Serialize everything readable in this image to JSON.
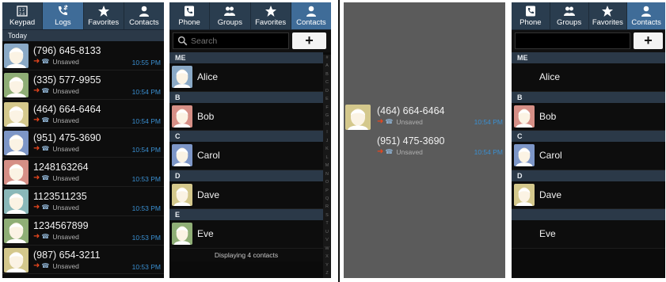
{
  "colors": {
    "tab_bar": "#2a3d4f",
    "tab_active": "#3f6c98",
    "section_header": "#2b3948",
    "time_blue": "#3a8fd1",
    "missed_arrow": "#e8461e"
  },
  "logs_screen": {
    "tabs": [
      {
        "label": "Keypad",
        "icon": "keypad-icon",
        "active": false
      },
      {
        "label": "Logs",
        "icon": "call-log-icon",
        "active": true
      },
      {
        "label": "Favorites",
        "icon": "star-icon",
        "active": false
      },
      {
        "label": "Contacts",
        "icon": "person-icon",
        "active": false
      }
    ],
    "date_header": "Today",
    "entries": [
      {
        "number": "(796) 645-8133",
        "status": "Unsaved",
        "time": "10:55 PM",
        "avatar_color": "#8aa9c6"
      },
      {
        "number": "(335) 577-9955",
        "status": "Unsaved",
        "time": "10:54 PM",
        "avatar_color": "#8fae76"
      },
      {
        "number": "(464) 664-6464",
        "status": "Unsaved",
        "time": "10:54 PM",
        "avatar_color": "#d4c88c"
      },
      {
        "number": "(951) 475-3690",
        "status": "Unsaved",
        "time": "10:54 PM",
        "avatar_color": "#7d96c7"
      },
      {
        "number": "1248163264",
        "status": "Unsaved",
        "time": "10:53 PM",
        "avatar_color": "#d68f86"
      },
      {
        "number": "1123511235",
        "status": "Unsaved",
        "time": "10:53 PM",
        "avatar_color": "#8ab8b9"
      },
      {
        "number": "1234567899",
        "status": "Unsaved",
        "time": "10:53 PM",
        "avatar_color": "#8fae76"
      },
      {
        "number": "(987) 654-3211",
        "status": "Unsaved",
        "time": "10:53 PM",
        "avatar_color": "#d4c88c"
      }
    ]
  },
  "contacts_screen": {
    "tabs": [
      {
        "label": "Phone",
        "icon": "phone-icon",
        "active": false
      },
      {
        "label": "Groups",
        "icon": "groups-icon",
        "active": false
      },
      {
        "label": "Favorites",
        "icon": "star-icon",
        "active": false
      },
      {
        "label": "Contacts",
        "icon": "person-icon",
        "active": true
      }
    ],
    "search_placeholder": "Search",
    "add_label": "+",
    "sections": [
      {
        "header": "ME",
        "name": "Alice",
        "avatar_color": "#8aa9c6"
      },
      {
        "header": "B",
        "name": "Bob",
        "avatar_color": "#d68f86"
      },
      {
        "header": "C",
        "name": "Carol",
        "avatar_color": "#7d96c7"
      },
      {
        "header": "D",
        "name": "Dave",
        "avatar_color": "#d4c88c"
      },
      {
        "header": "E",
        "name": "Eve",
        "avatar_color": "#8fae76"
      }
    ],
    "index_letters": [
      "#",
      "A",
      "B",
      "C",
      "D",
      "E",
      "F",
      "G",
      "H",
      "I",
      "J",
      "K",
      "L",
      "M",
      "N",
      "O",
      "P",
      "Q",
      "R",
      "S",
      "T",
      "U",
      "V",
      "W",
      "X",
      "Y",
      "Z"
    ],
    "footer": "Displaying 4 contacts"
  },
  "drag_screen": {
    "entries": [
      {
        "number": "(464) 664-6464",
        "status": "Unsaved",
        "time": "10:54 PM",
        "avatar_color": "#d4c88c",
        "has_avatar": true
      },
      {
        "number": "(951) 475-3690",
        "status": "Unsaved",
        "time": "10:54 PM",
        "has_avatar": false
      }
    ]
  },
  "contacts_screen_2": {
    "tabs": [
      {
        "label": "Phone",
        "icon": "phone-icon",
        "active": false
      },
      {
        "label": "Groups",
        "icon": "groups-icon",
        "active": false
      },
      {
        "label": "Favorites",
        "icon": "star-icon",
        "active": false
      },
      {
        "label": "Contacts",
        "icon": "person-icon",
        "active": true
      }
    ],
    "add_label": "+",
    "sections": [
      {
        "header": "ME",
        "name": "Alice",
        "has_avatar": false
      },
      {
        "header": "B",
        "name": "Bob",
        "avatar_color": "#d68f86",
        "has_avatar": true
      },
      {
        "header": "C",
        "name": "Carol",
        "avatar_color": "#7d96c7",
        "has_avatar": true
      },
      {
        "header": "D",
        "name": "Dave",
        "avatar_color": "#d4c88c",
        "has_avatar": true
      },
      {
        "header": "",
        "name": "Eve",
        "has_avatar": false
      }
    ]
  }
}
